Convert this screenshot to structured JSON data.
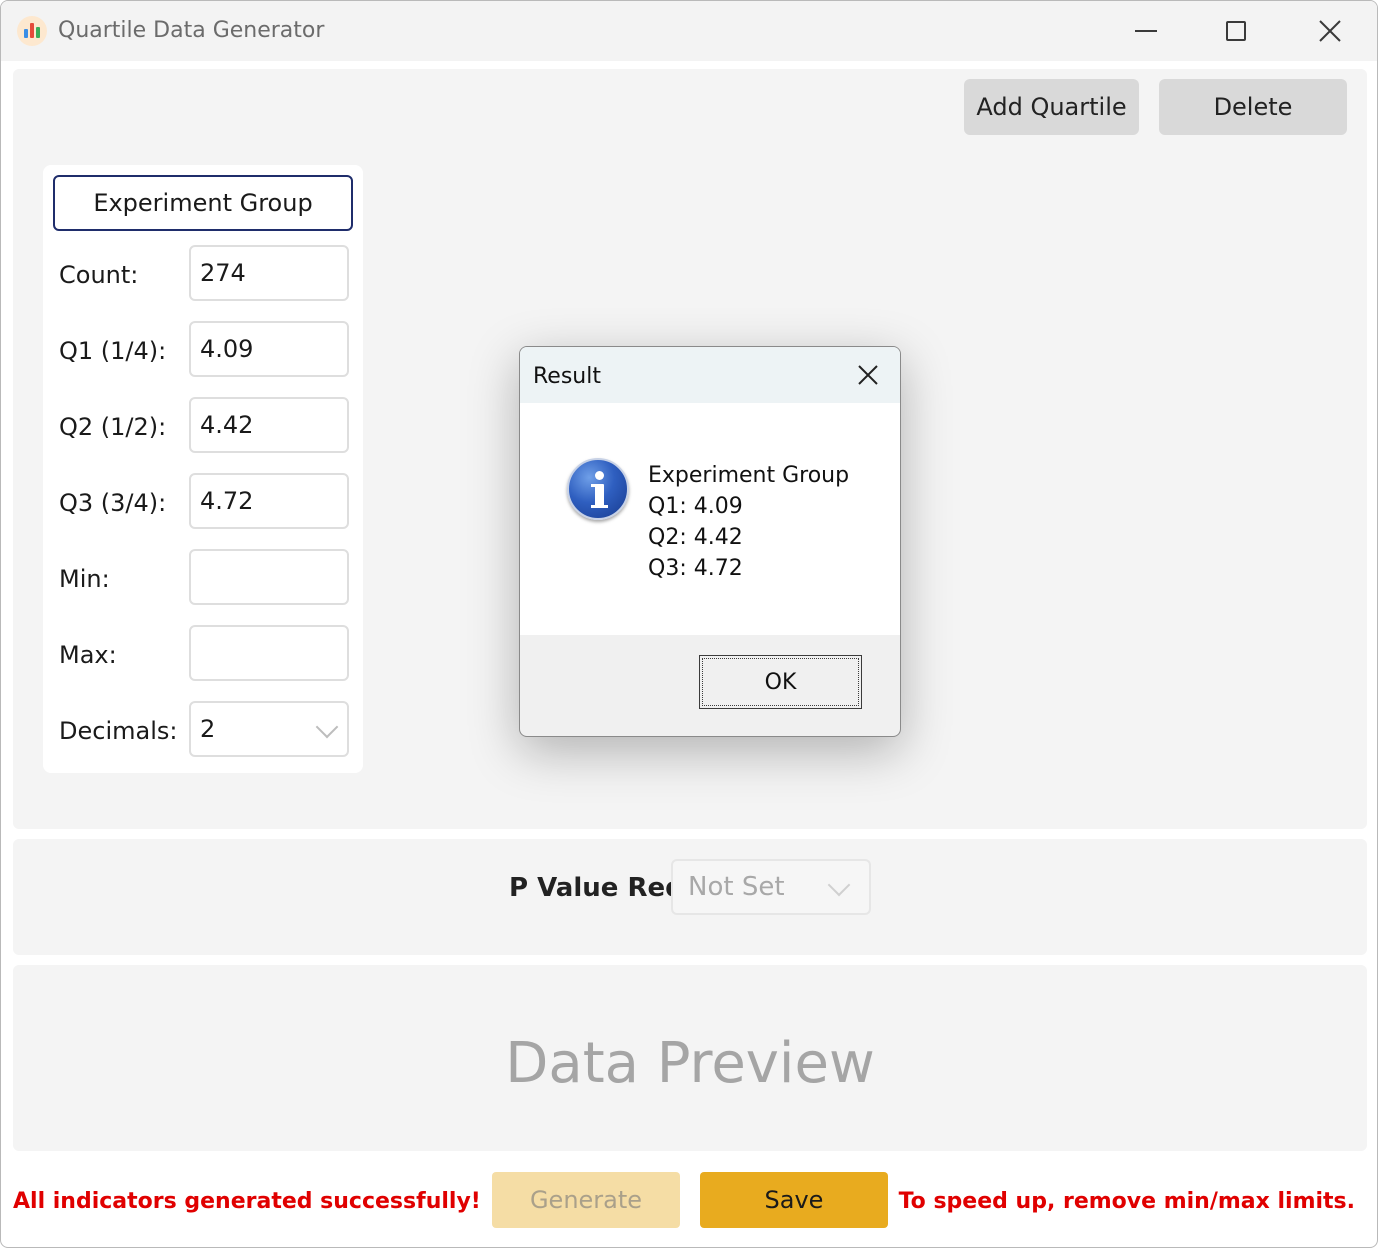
{
  "window": {
    "title": "Quartile Data Generator",
    "minimize_icon": "minimize-icon",
    "maximize_icon": "maximize-icon",
    "close_icon": "close-icon"
  },
  "toolbar": {
    "add_quartile_label": "Add Quartile",
    "delete_label": "Delete"
  },
  "group": {
    "name": "Experiment Group",
    "fields": {
      "count": {
        "label": "Count:",
        "value": "274"
      },
      "q1": {
        "label": "Q1 (1/4):",
        "value": "4.09"
      },
      "q2": {
        "label": "Q2 (1/2):",
        "value": "4.42"
      },
      "q3": {
        "label": "Q3 (3/4):",
        "value": "4.72"
      },
      "min": {
        "label": "Min:",
        "value": ""
      },
      "max": {
        "label": "Max:",
        "value": ""
      },
      "decimals": {
        "label": "Decimals:",
        "value": "2"
      }
    }
  },
  "pvalue": {
    "label": "P Value Req:",
    "value": "Not Set"
  },
  "preview": {
    "placeholder": "Data Preview"
  },
  "footer": {
    "status_left": "All indicators generated successfully!",
    "generate_label": "Generate",
    "save_label": "Save",
    "status_right": "To speed up, remove min/max limits."
  },
  "dialog": {
    "title": "Result",
    "lines": [
      "Experiment Group",
      "Q1: 4.09",
      "Q2: 4.42",
      "Q3: 4.72"
    ],
    "ok_label": "OK",
    "icon": "info-icon"
  },
  "colors": {
    "accent_save": "#e8ab1f",
    "generate_disabled": "#f5dda5",
    "status_text": "#e00000",
    "group_border": "#1f2d6b"
  }
}
